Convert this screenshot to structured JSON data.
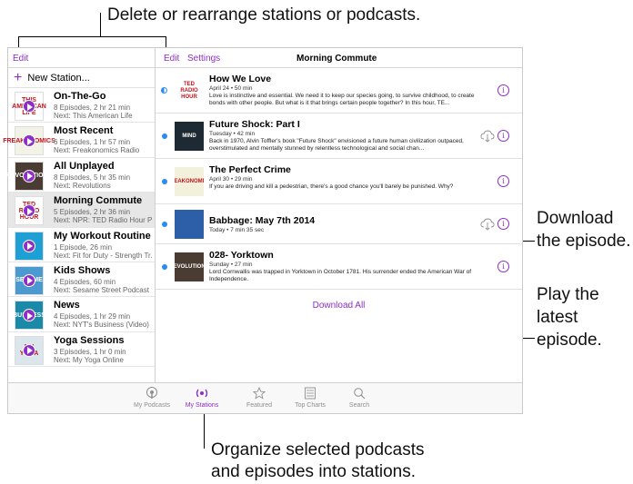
{
  "callouts": {
    "top": "Delete or rearrange stations or podcasts.",
    "download_line1": "Download",
    "download_line2": "the episode.",
    "play_line1": "Play the",
    "play_line2": "latest",
    "play_line3": "episode.",
    "bottom_line1": "Organize selected podcasts",
    "bottom_line2": "and episodes into stations."
  },
  "sidebar": {
    "edit_label": "Edit",
    "new_station_label": "New Station...",
    "stations": [
      {
        "title": "On-The-Go",
        "sub1": "8 Episodes, 2 hr 21 min",
        "sub2": "Next: This American Life",
        "art": "THIS AMERICAN LIFE",
        "color": "#ffffff"
      },
      {
        "title": "Most Recent",
        "sub1": "6 Episodes, 1 hr 57 min",
        "sub2": "Next: Freakonomics Radio",
        "art": "FREAKONOMICS",
        "color": "#f2f2e6"
      },
      {
        "title": "All Unplayed",
        "sub1": "8 Episodes, 5 hr 35 min",
        "sub2": "Next: Revolutions",
        "art": "REVOLUTIONS",
        "color": "#4a3c32"
      },
      {
        "title": "Morning Commute",
        "sub1": "5 Episodes, 2 hr 36 min",
        "sub2": "Next: NPR: TED Radio Hour P...",
        "art": "TED RADIO HOUR",
        "color": "#ffffff"
      },
      {
        "title": "My Workout Routine",
        "sub1": "1 Episode, 26 min",
        "sub2": "Next: Fit for Duty - Strength Tr...",
        "art": "FIT",
        "color": "#1e9fd6"
      },
      {
        "title": "Kids Shows",
        "sub1": "4 Episodes, 60 min",
        "sub2": "Next: Sesame Street Podcast",
        "art": "SESAME",
        "color": "#4a9ad0"
      },
      {
        "title": "News",
        "sub1": "4 Episodes, 1 hr 29 min",
        "sub2": "Next: NYT's Business (Video)",
        "art": "BUSINESS",
        "color": "#1a8aa8"
      },
      {
        "title": "Yoga Sessions",
        "sub1": "3 Episodes, 1 hr 0 min",
        "sub2": "Next: My Yoga Online",
        "art": "MY YOGA",
        "color": "#dbe6ec"
      }
    ]
  },
  "main": {
    "edit_label": "Edit",
    "settings_label": "Settings",
    "title": "Morning Commute",
    "download_all_label": "Download All",
    "episodes": [
      {
        "title": "How We Love",
        "meta": "April 24 • 50 min",
        "desc": "Love is instinctive and essential. We need it to keep our species going, to survive childhood, to create bonds with other people. But what is it that brings certain people together? In this hour, TE...",
        "art": "TED RADIO HOUR",
        "color": "#ffffff"
      },
      {
        "title": "Future Shock: Part I",
        "meta": "Tuesday • 42 min",
        "desc": "Back in 1970, Alvin Toffler's book \"Future Shock\" envisioned a future human civilization outpaced, overstimulated and mentally stunned by relentless technological and social chan...",
        "art": "MIND",
        "color": "#1d2a33"
      },
      {
        "title": "The Perfect Crime",
        "meta": "April 30 • 29 min",
        "desc": "If you are driving and kill a pedestrian, there's a good chance you'll barely be punished. Why?",
        "art": "FREAKONOMICS",
        "color": "#f3f0dc"
      },
      {
        "title": "Babbage: May 7th 2014",
        "meta": "Today • 7 min 35 sec",
        "desc": "",
        "art": "",
        "color": "#2c5fa8"
      },
      {
        "title": "028- Yorktown",
        "meta": "Sunday • 27 min",
        "desc": "Lord Cornwallis was trapped in Yorktown in October 1781. His surrender ended the American War of Independence.",
        "art": "REVOLUTIONS",
        "color": "#4a3c32"
      }
    ]
  },
  "tabs": [
    {
      "label": "My Podcasts",
      "icon": "podcast-icon"
    },
    {
      "label": "My Stations",
      "icon": "radio-waves-icon"
    },
    {
      "label": "Featured",
      "icon": "star-icon"
    },
    {
      "label": "Top Charts",
      "icon": "list-icon"
    },
    {
      "label": "Search",
      "icon": "search-icon"
    }
  ],
  "colors": {
    "accent": "#8c2ec7",
    "unplayed": "#2a8bf2"
  }
}
